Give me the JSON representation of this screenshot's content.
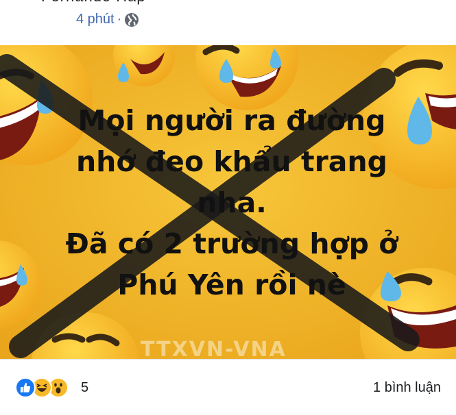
{
  "header": {
    "cut_text": "Fernando Hap",
    "timestamp": "4 phút",
    "separator": "·",
    "privacy_icon": "globe-icon"
  },
  "image": {
    "caption_lines": [
      "Mọi người ra đường",
      "nhớ đeo khẩu trang",
      "nha.",
      "Đã có 2 trường hợp ở",
      "Phú Yên rồi nè"
    ],
    "watermark": "TTXVN-VNA",
    "background_color": "#f3b626",
    "cross_color": "#1a1a1a"
  },
  "reactions": {
    "icons": [
      "like-icon",
      "haha-icon",
      "wow-icon"
    ],
    "count": "5",
    "comments": "1 bình luận"
  }
}
